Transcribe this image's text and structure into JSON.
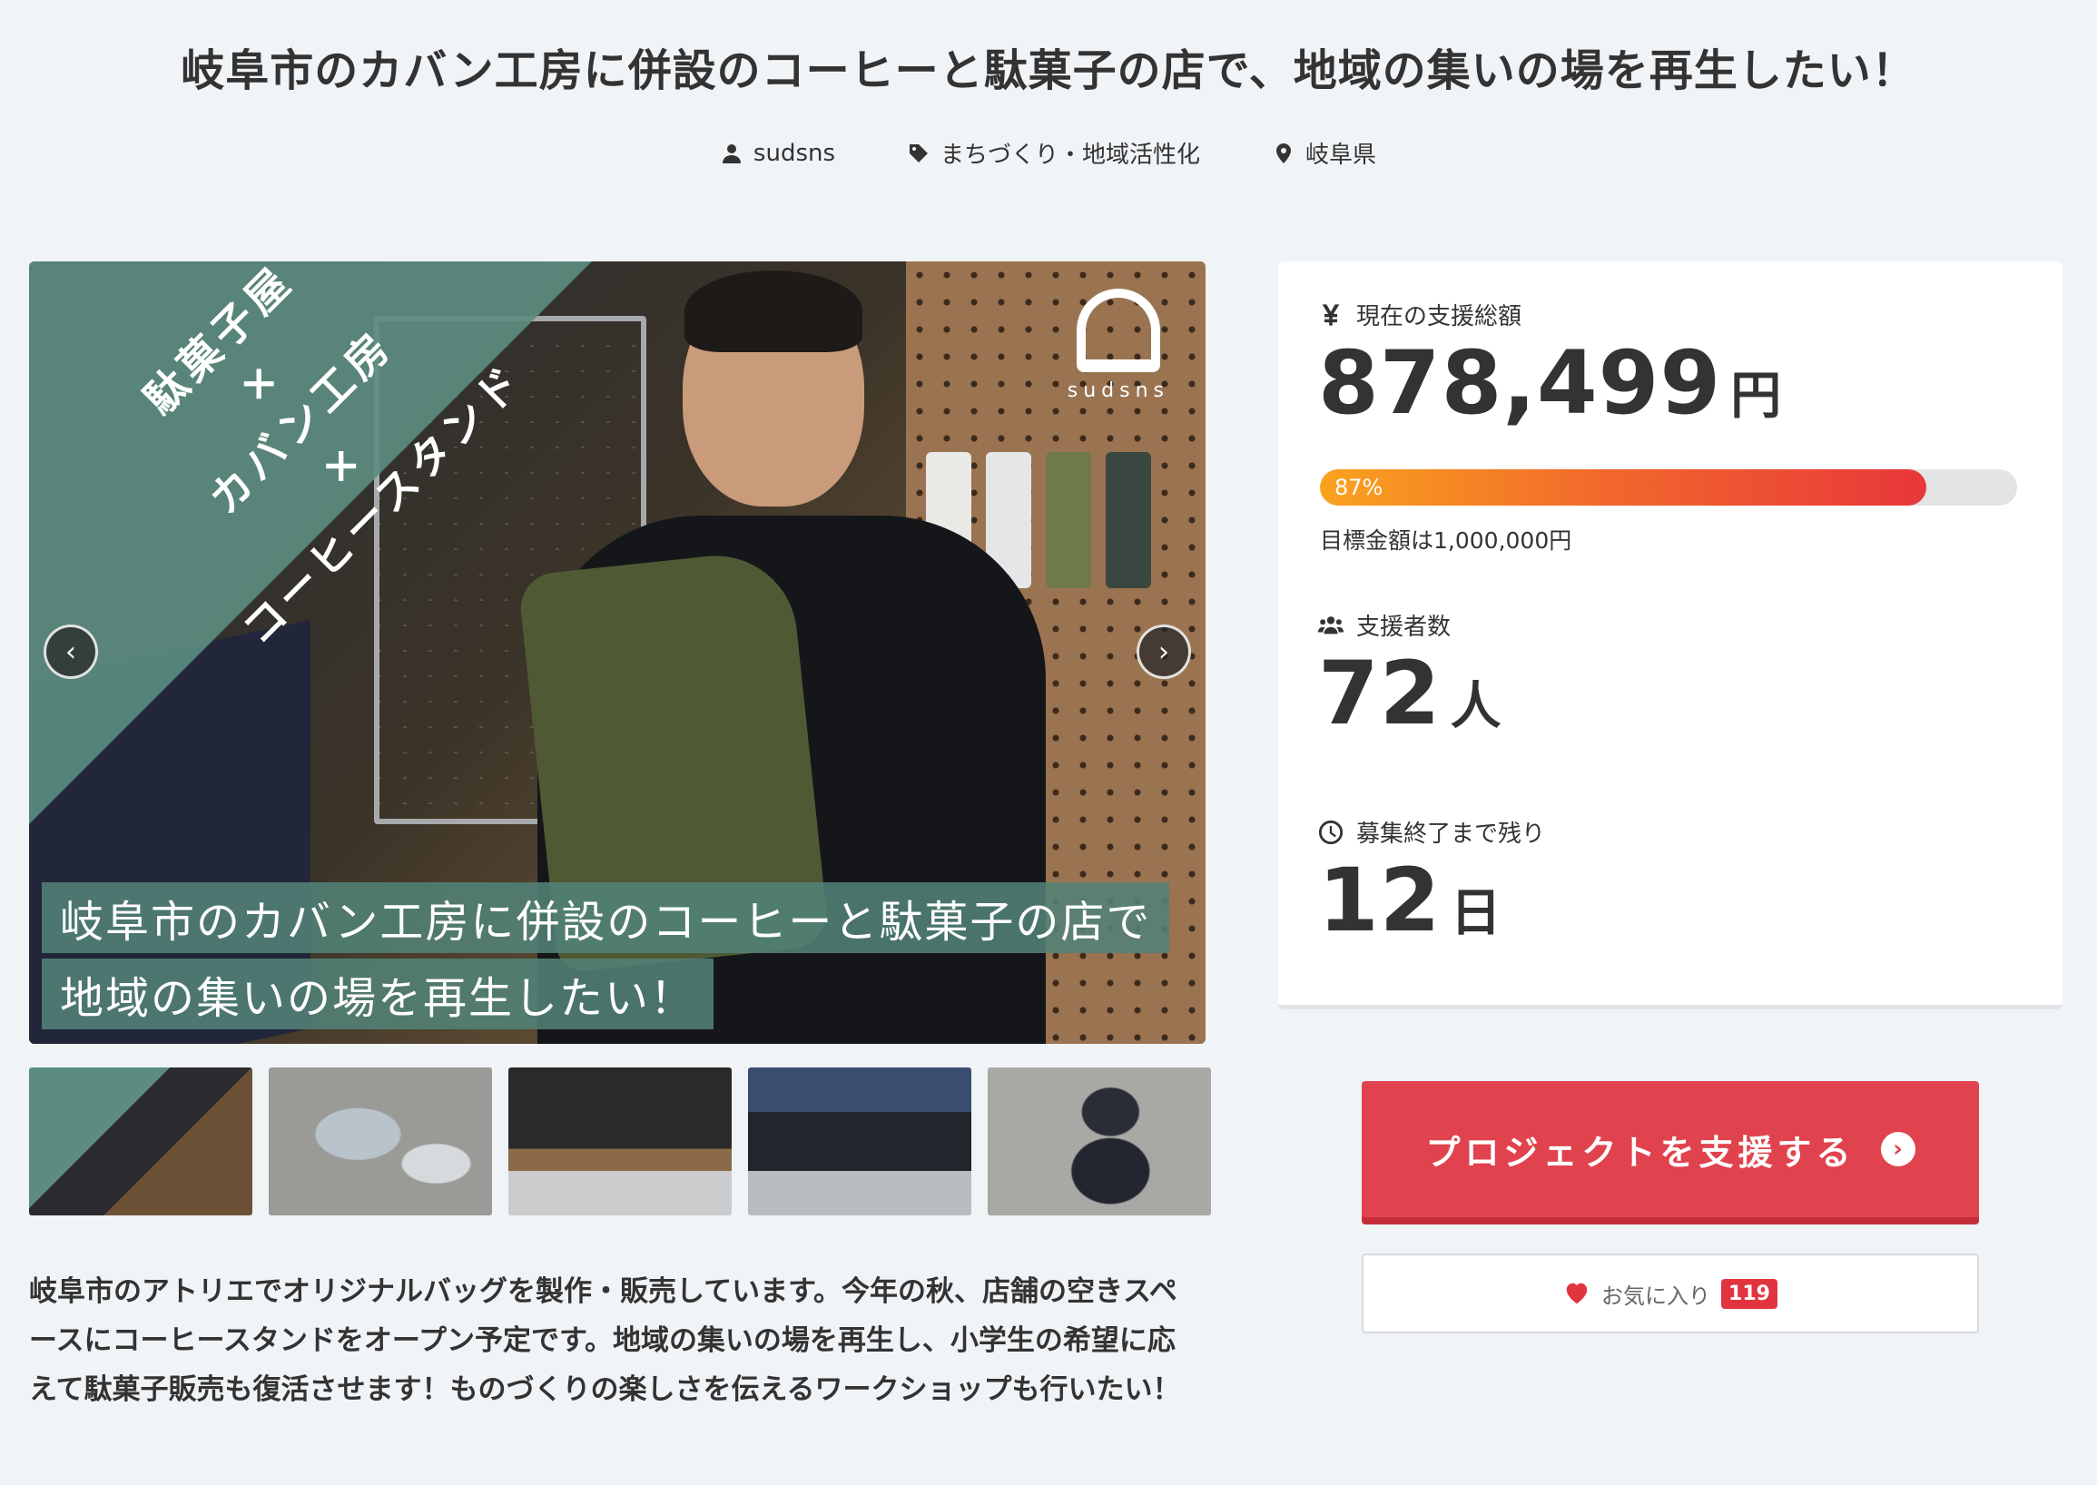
{
  "project": {
    "title": "岐阜市のカバン工房に併設のコーヒーと駄菓子の店で、地域の集いの場を再生したい！",
    "owner": "sudsns",
    "category": "まちづくり・地域活性化",
    "location": "岐阜県"
  },
  "hero": {
    "diagonal_lines": [
      "駄菓子屋",
      "×",
      "カバン工房",
      "×",
      "コーヒースタンド"
    ],
    "caption_line1": "岐阜市のカバン工房に併設のコーヒーと駄菓子の店で",
    "caption_line2": "地域の集いの場を再生したい！",
    "brand": "sudsns",
    "prev_glyph": "‹",
    "next_glyph": "›"
  },
  "thumbnails": [
    {
      "name": "thumb-1"
    },
    {
      "name": "thumb-2"
    },
    {
      "name": "thumb-3"
    },
    {
      "name": "thumb-4"
    },
    {
      "name": "thumb-5"
    }
  ],
  "description": "岐阜市のアトリエでオリジナルバッグを製作・販売しています。今年の秋、店舗の空きスペースにコーヒースタンドをオープン予定です。地域の集いの場を再生し、小学生の希望に応えて駄菓子販売も復活させます！ものづくりの楽しさを伝えるワークショップも行いたい！",
  "stats": {
    "total_label": "現在の支援総額",
    "total_amount": "878,499",
    "total_unit": "円",
    "progress_percent": 87,
    "progress_label": "87%",
    "goal_text": "目標金額は1,000,000円",
    "backers_label": "支援者数",
    "backers_count": "72",
    "backers_unit": "人",
    "remaining_label": "募集終了まで残り",
    "remaining_days": "12",
    "remaining_unit": "日"
  },
  "actions": {
    "support_label": "プロジェクトを支援する",
    "favorite_label": "お気に入り",
    "favorite_count": "119"
  },
  "icons": {
    "owner": "user-icon",
    "category": "tag-icon",
    "location": "map-pin-icon",
    "total": "yen-icon",
    "backers": "users-icon",
    "remaining": "clock-icon",
    "favorite": "heart-icon"
  },
  "colors": {
    "accent": "#e0434d",
    "background": "#f1f4f7",
    "progress_start": "#f9a31e",
    "progress_end": "#e8373a"
  }
}
